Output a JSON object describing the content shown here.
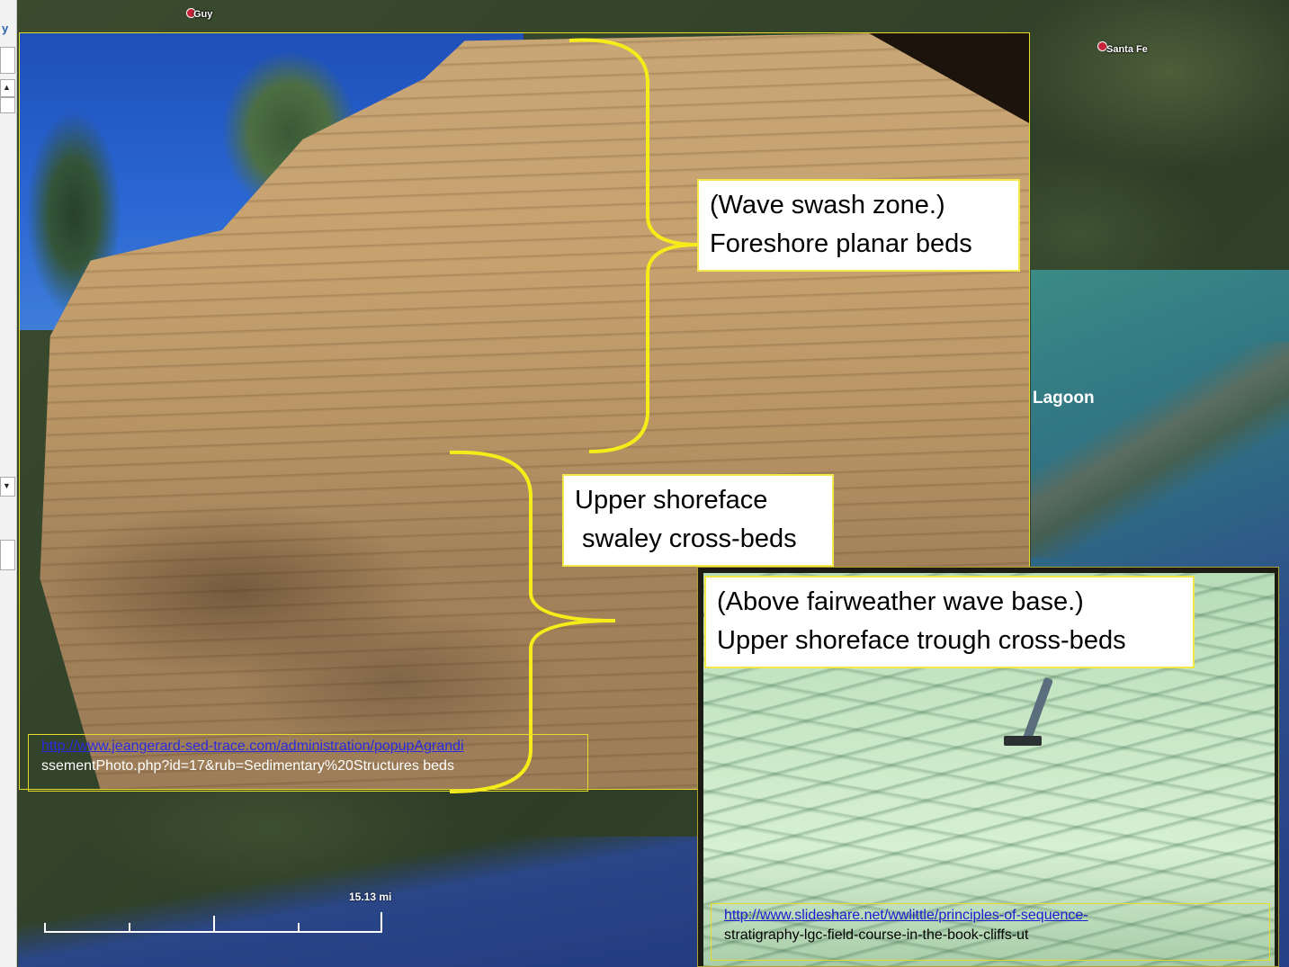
{
  "map": {
    "places": [
      {
        "label": "Guy"
      },
      {
        "label": "Santa Fe"
      }
    ],
    "lagoon_label": "Lagoon",
    "scale_label": "15.13 mi"
  },
  "sidebar": {
    "letter": "y"
  },
  "callouts": {
    "swash": "(Wave swash zone.)\nForeshore planar beds",
    "swaley": "Upper shoreface\n swaley cross-beds",
    "trough": "(Above fairweather wave base.)\nUpper shoreface trough cross-beds"
  },
  "citations": {
    "main": {
      "link": "http://www.jeangerard-sed-trace.com/administration/popupAgrandi",
      "rest": "ssementPhoto.php?id=17&rub=Sedimentary%20Structures beds"
    },
    "inset": {
      "link": "http://www.slideshare.net/wwlittle/principles-of-sequence-",
      "rest": "stratigraphy-lgc-field-course-in-the-book-cliffs-ut"
    }
  },
  "colors": {
    "bracket": "#f5ec1a",
    "callout_border": "#f3e84a",
    "link": "#2a2adf"
  }
}
